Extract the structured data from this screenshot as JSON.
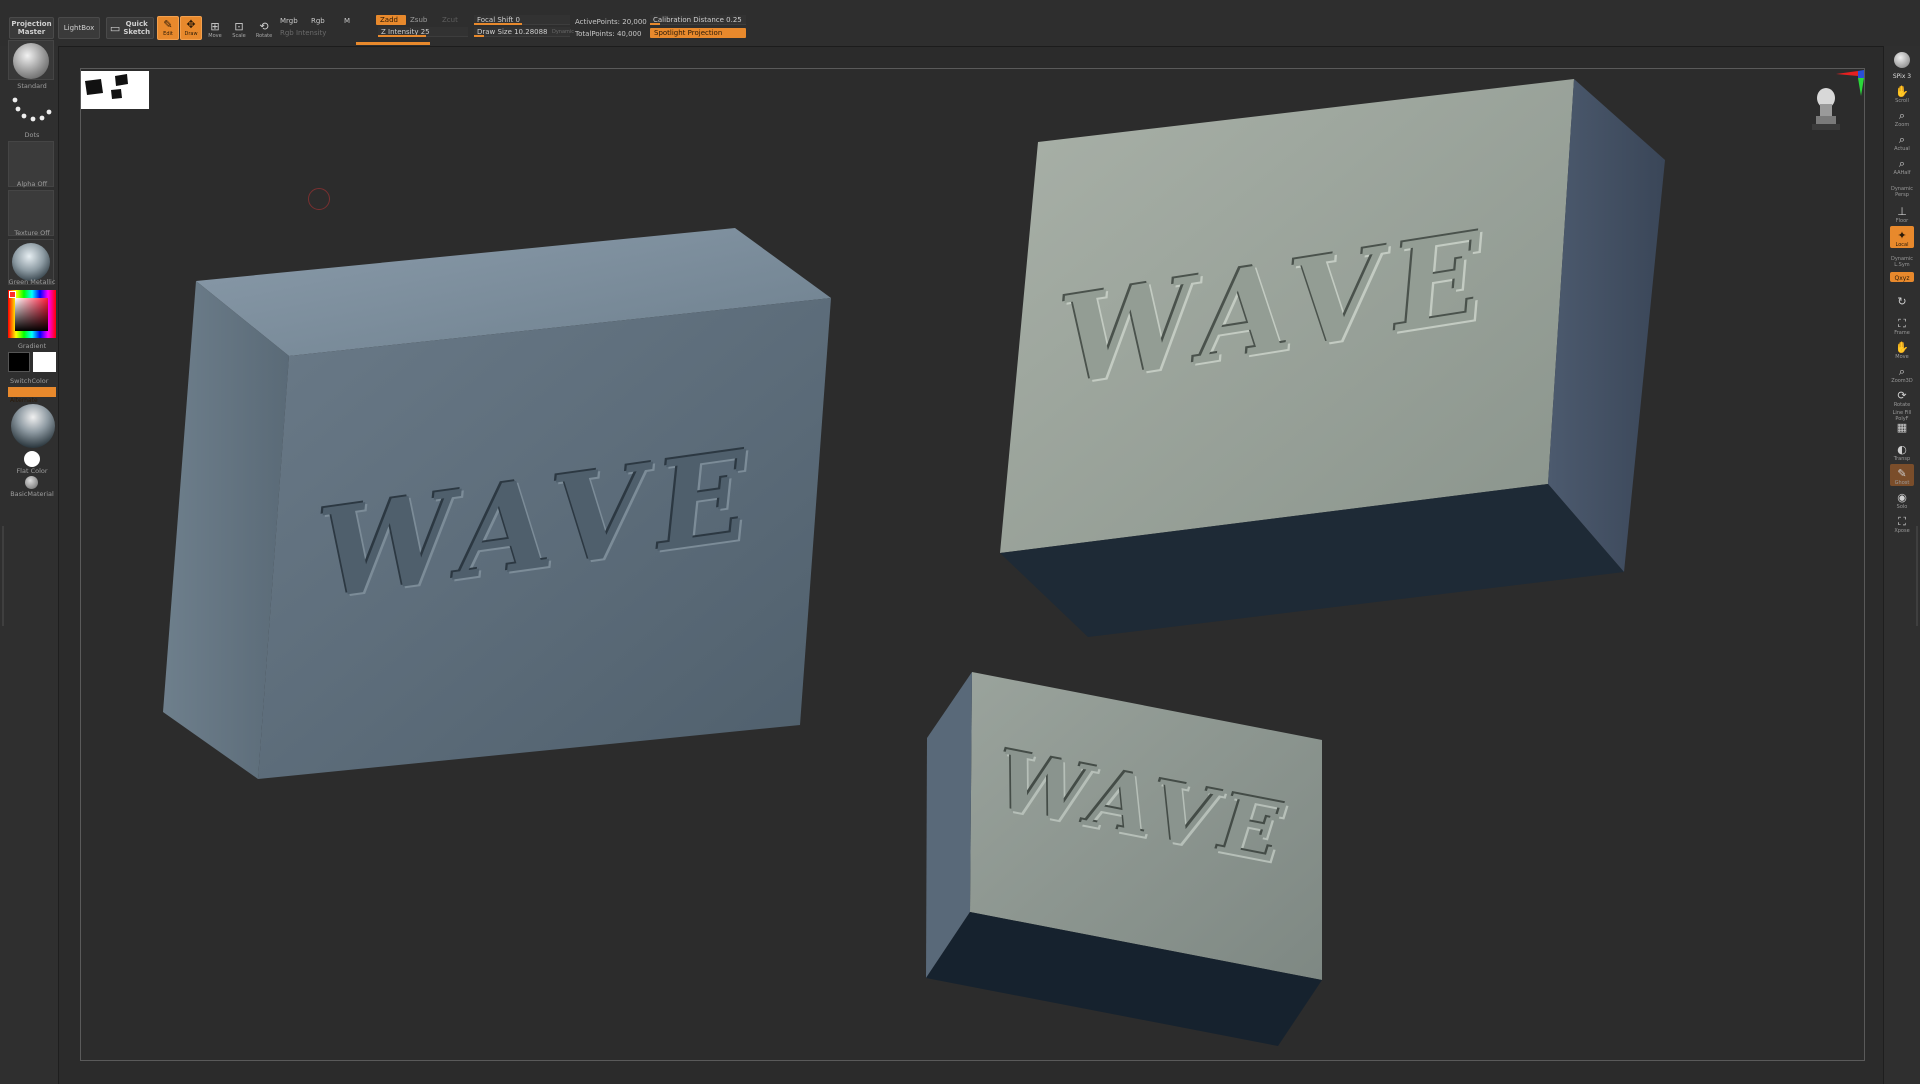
{
  "top": {
    "projection_master": "Projection\nMaster",
    "lightbox": "LightBox",
    "quick_sketch": "Quick\nSketch",
    "edit": "Edit",
    "draw": "Draw",
    "move": "Move",
    "scale": "Scale",
    "rotate": "Rotate",
    "mrgb": "Mrgb",
    "rgb": "Rgb",
    "m": "M",
    "rgb_intensity": "Rgb Intensity",
    "zadd": "Zadd",
    "zsub": "Zsub",
    "zcut": "Zcut",
    "z_intensity": "Z Intensity 25",
    "focal_shift": "Focal Shift 0",
    "draw_size": "Draw Size 10.28088",
    "dynamic": "Dynamic",
    "active_points": "ActivePoints: 20,000",
    "total_points": "TotalPoints: 40,000",
    "calibration_distance": "Calibration Distance 0.25",
    "spotlight_projection": "Spotlight Projection"
  },
  "left": {
    "brush": "Standard",
    "stroke": "Dots",
    "alpha": "Alpha Off",
    "texture": "Texture Off",
    "material": "Green Metallic",
    "gradient": "Gradient",
    "switch_color": "SwitchColor",
    "alternate": "Alternate",
    "flat_color": "Flat Color",
    "basic_material": "BasicMaterial"
  },
  "right": {
    "bpr": "BPR",
    "spix": "SPix 3",
    "scroll": "Scroll",
    "zoom": "Zoom",
    "actual": "Actual",
    "aahalf": "AAHalf",
    "dynamic_persp": "Dynamic\nPersp",
    "floor": "Floor",
    "local": "Local",
    "dynamic2": "Dynamic",
    "l_sym": "L.Sym",
    "xyz": "Qxyz",
    "frame": "Frame",
    "move": "Move",
    "zoom3d": "Zoom3D",
    "rotate": "Rotate",
    "line_fill": "Line Fill\nPolyF",
    "transp": "Transp",
    "ghost": "Ghost",
    "solo": "Solo",
    "xpose": "Xpose"
  },
  "model_text": "WAVE",
  "colors": {
    "accent": "#e8892c",
    "block_left_front": "#5b6b78",
    "block_right_front": "#9aa49c"
  }
}
